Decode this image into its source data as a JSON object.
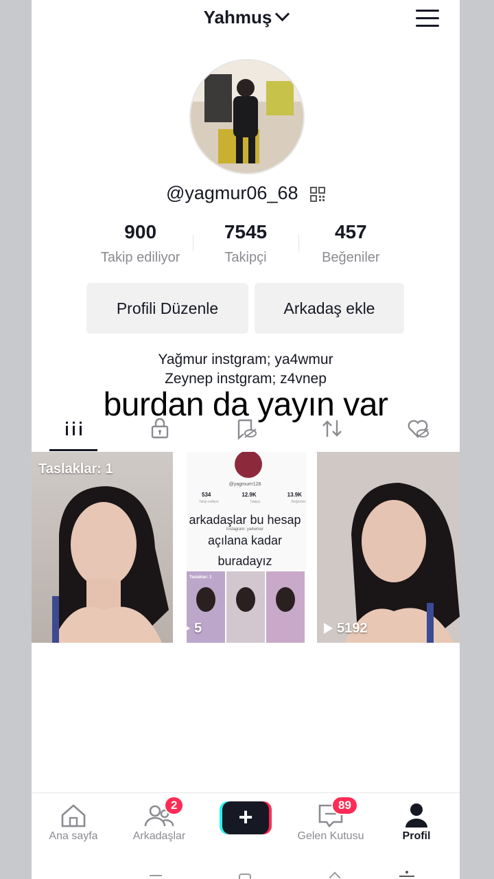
{
  "header": {
    "title": "Yahmuş"
  },
  "profile": {
    "handle": "@yagmur06_68",
    "stats": [
      {
        "value": "900",
        "label": "Takip ediliyor"
      },
      {
        "value": "7545",
        "label": "Takipçi"
      },
      {
        "value": "457",
        "label": "Beğeniler"
      }
    ],
    "edit_button": "Profili Düzenle",
    "add_friend_button": "Arkadaş ekle",
    "bio_lines": [
      "Yağmur instgram; ya4wmur",
      "Zeynep instgram; z4vnep"
    ]
  },
  "overlay_caption": "burdan da yayın var",
  "tabs": [
    "videos-grid-icon",
    "lock-icon",
    "saved-hidden-icon",
    "repost-icon",
    "liked-hidden-icon"
  ],
  "videos": [
    {
      "caption": "Taslaklar: 1"
    },
    {
      "views": "5",
      "embedded": {
        "handle": "@yagmurrr128",
        "stats": [
          "534",
          "12.9K",
          "13.9K"
        ],
        "stat_labels": [
          "Takip ediliyor",
          "Takipçi",
          "Beğeniler"
        ],
        "bio": "Instagram: ya4wmur",
        "drafts": "Taslaklar: 1",
        "text_lines": [
          "arkadaşlar bu hesap",
          "açılana kadar",
          "buradayız"
        ]
      }
    },
    {
      "views": "5192"
    }
  ],
  "nav": [
    {
      "label": "Ana sayfa",
      "icon": "home-icon"
    },
    {
      "label": "Arkadaşlar",
      "icon": "friends-icon",
      "badge": "2"
    },
    {
      "label": "",
      "icon": "create-plus-icon"
    },
    {
      "label": "Gelen Kutusu",
      "icon": "inbox-icon",
      "badge": "89"
    },
    {
      "label": "Profil",
      "icon": "profile-icon"
    }
  ],
  "colors": {
    "accent": "#fe2c55",
    "text": "#161823",
    "muted": "#8a8b91",
    "cyan": "#25f4ee"
  }
}
